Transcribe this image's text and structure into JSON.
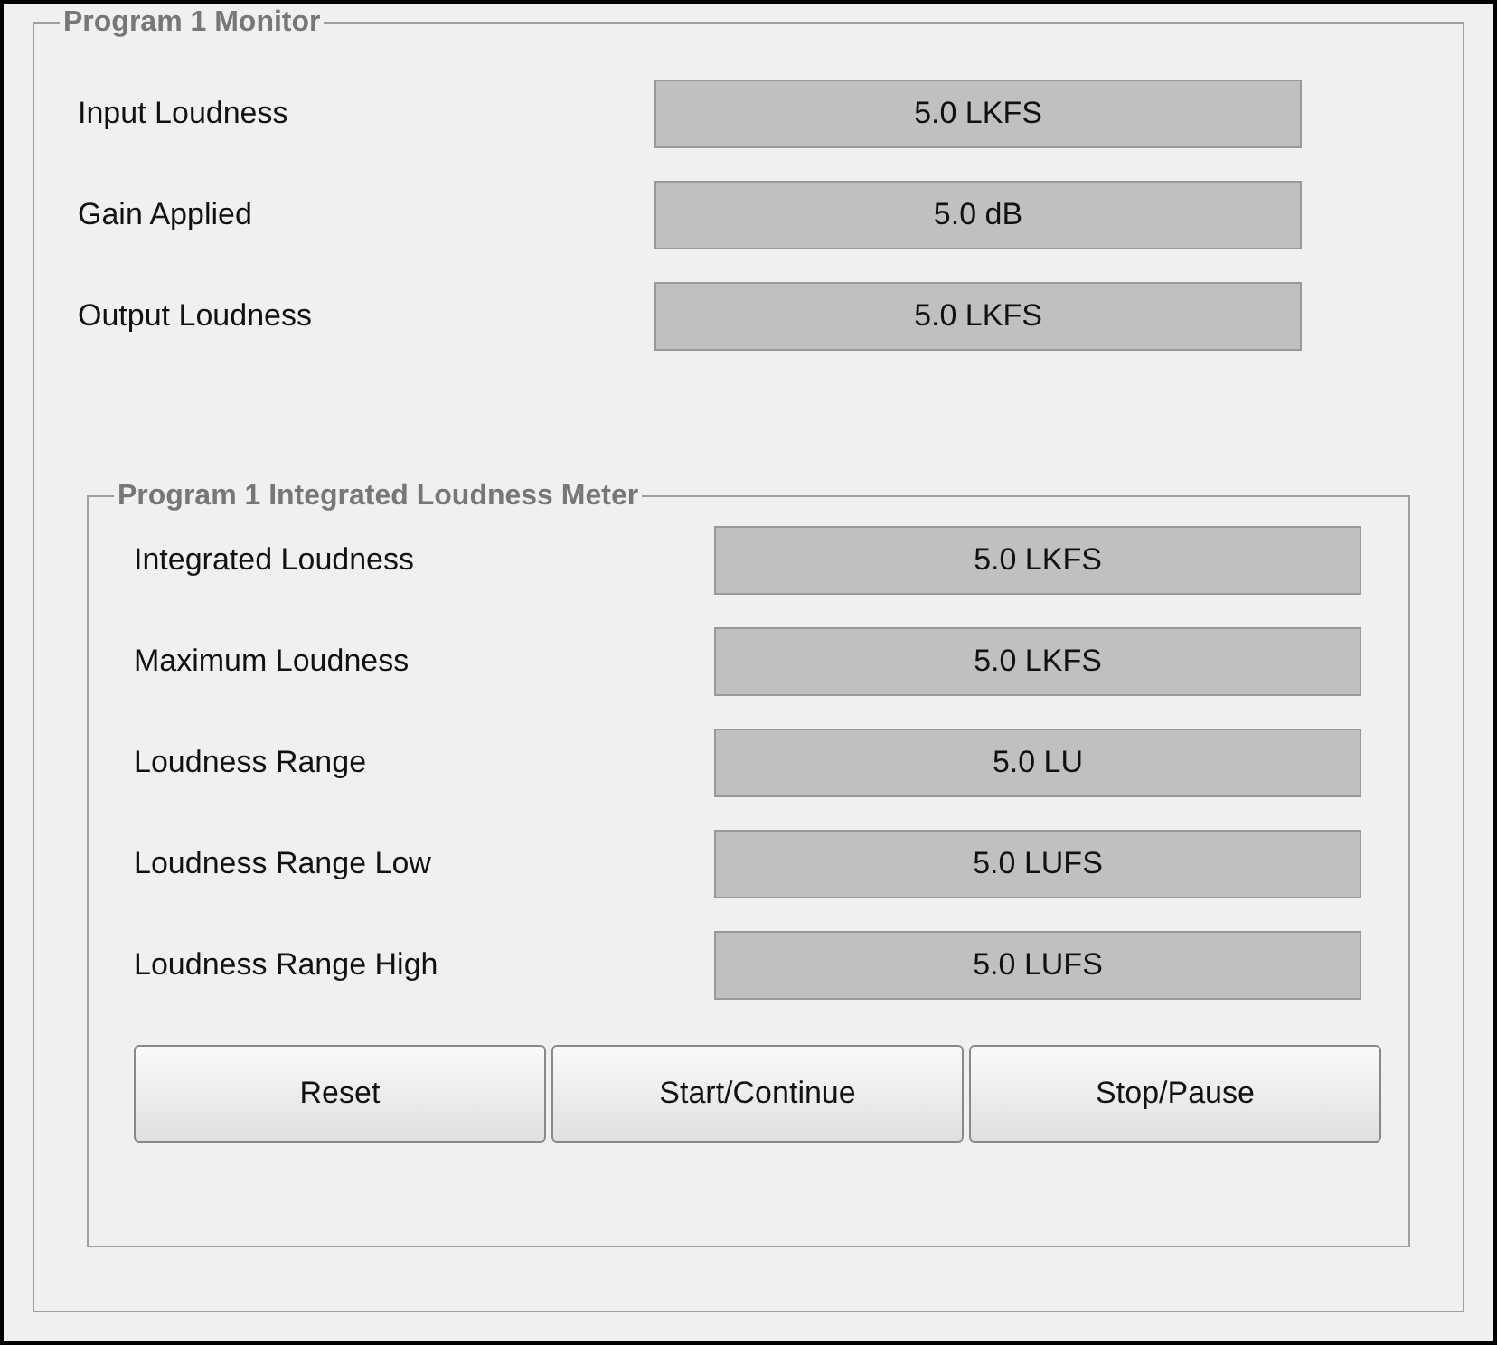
{
  "monitor": {
    "title": "Program 1 Monitor",
    "rows": [
      {
        "label": "Input Loudness",
        "value": "5.0 LKFS"
      },
      {
        "label": "Gain Applied",
        "value": "5.0 dB"
      },
      {
        "label": "Output Loudness",
        "value": "5.0 LKFS"
      }
    ],
    "meter": {
      "title": "Program 1 Integrated Loudness Meter",
      "rows": [
        {
          "label": "Integrated Loudness",
          "value": "5.0 LKFS"
        },
        {
          "label": "Maximum Loudness",
          "value": "5.0 LKFS"
        },
        {
          "label": "Loudness Range",
          "value": "5.0 LU"
        },
        {
          "label": "Loudness Range Low",
          "value": "5.0 LUFS"
        },
        {
          "label": "Loudness Range High",
          "value": "5.0 LUFS"
        }
      ],
      "buttons": [
        "Reset",
        "Start/Continue",
        "Stop/Pause"
      ]
    }
  }
}
